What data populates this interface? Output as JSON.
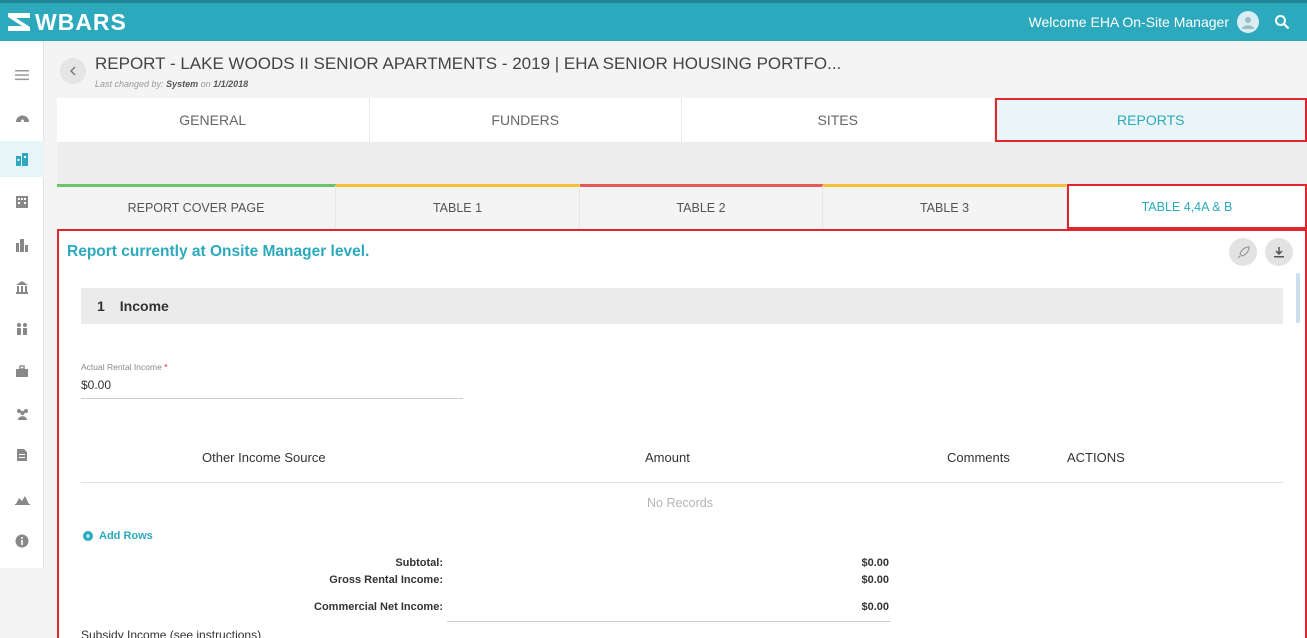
{
  "app": {
    "logo_text": "WBARS",
    "welcome": "Welcome EHA On-Site Manager"
  },
  "sidebar": {
    "items": [
      {
        "icon": "menu-icon"
      },
      {
        "icon": "dashboard-icon"
      },
      {
        "icon": "properties-icon",
        "active": true
      },
      {
        "icon": "building-icon"
      },
      {
        "icon": "city-icon"
      },
      {
        "icon": "bank-icon"
      },
      {
        "icon": "family-icon"
      },
      {
        "icon": "briefcase-icon"
      },
      {
        "icon": "users-icon"
      },
      {
        "icon": "document-icon"
      },
      {
        "icon": "chart-icon"
      },
      {
        "icon": "info-icon"
      }
    ]
  },
  "header": {
    "title": "REPORT - LAKE WOODS II SENIOR APARTMENTS - 2019 | EHA SENIOR HOUSING PORTFO...",
    "last_changed_prefix": "Last changed by: ",
    "last_changed_user": "System",
    "last_changed_on": " on ",
    "last_changed_date": "1/1/2018"
  },
  "main_tabs": [
    {
      "label": "GENERAL"
    },
    {
      "label": "FUNDERS"
    },
    {
      "label": "SITES"
    },
    {
      "label": "REPORTS",
      "active": true
    }
  ],
  "sub_tabs": [
    {
      "label": "REPORT COVER PAGE",
      "color": "#6cc36a"
    },
    {
      "label": "TABLE 1",
      "color": "#f3c234"
    },
    {
      "label": "TABLE 2",
      "color": "#e8585a"
    },
    {
      "label": "TABLE 3",
      "color": "#f3c234"
    },
    {
      "label": "TABLE 4,4A & B",
      "color": "#e0262d",
      "active": true
    }
  ],
  "content": {
    "status": "Report currently at Onsite Manager level.",
    "section_number": "1",
    "section_title": "Income",
    "actual_rental_label": "Actual Rental Income",
    "required_mark": "*",
    "actual_rental_value": "$0.00",
    "table": {
      "headers": [
        "Other Income Source",
        "Amount",
        "Comments",
        "ACTIONS"
      ],
      "empty_text": "No Records"
    },
    "add_rows": "Add Rows",
    "totals": [
      {
        "label": "Subtotal:",
        "value": "$0.00"
      },
      {
        "label": "Gross Rental Income:",
        "value": "$0.00"
      },
      {
        "label": "Commercial Net Income:",
        "value": "$0.00"
      }
    ],
    "subsidy": "Subsidy Income (see instructions)"
  },
  "colors": {
    "accent": "#2ca9bd",
    "highlight": "#e0262d"
  }
}
